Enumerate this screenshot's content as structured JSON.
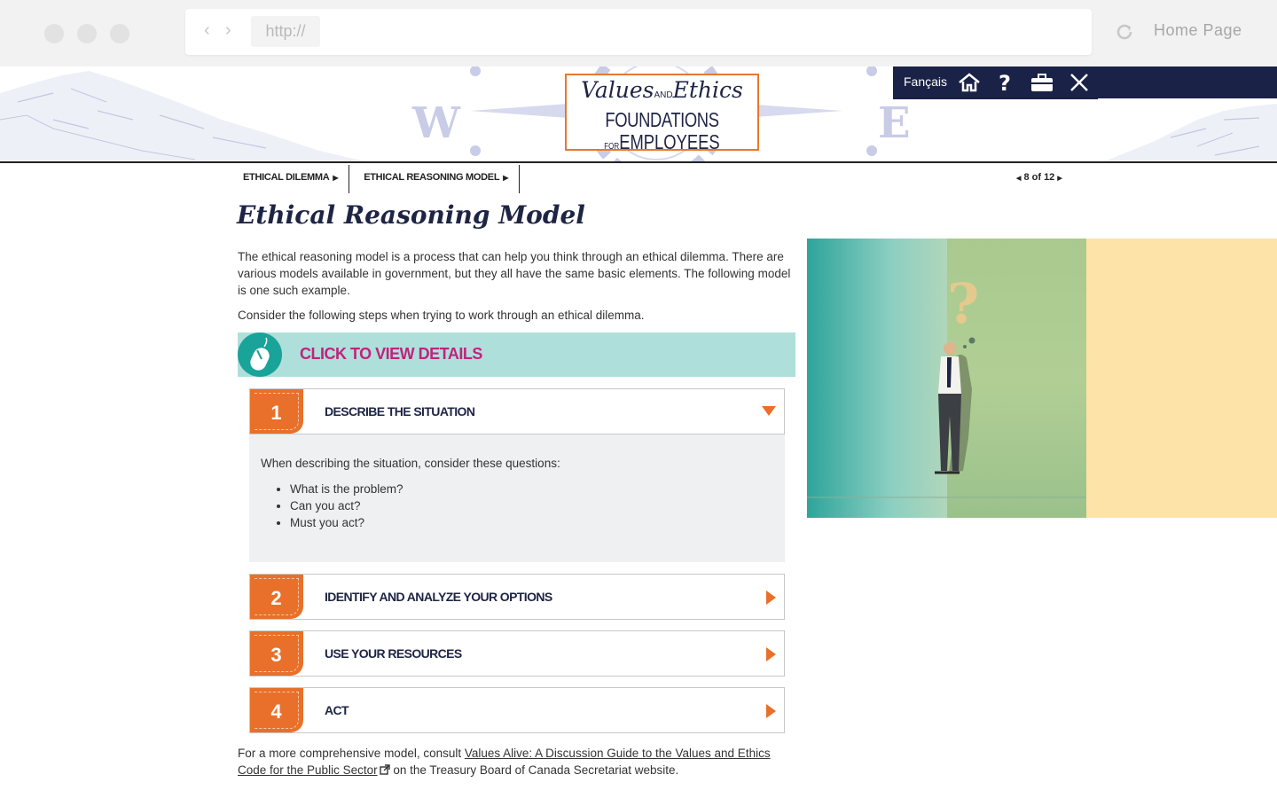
{
  "browser": {
    "url": "http://",
    "home_label": "Home Page"
  },
  "toolbar": {
    "language": "Fançais"
  },
  "logo": {
    "line1_a": "Values",
    "line1_and": "AND",
    "line1_b": "Ethics",
    "line2": "FOUNDATIONS",
    "line3_for": "FOR",
    "line3": "EMPLOYEES"
  },
  "breadcrumb": {
    "items": [
      "ETHICAL DILEMMA",
      "ETHICAL REASONING MODEL"
    ],
    "pager": "8 of 12"
  },
  "page": {
    "title": "Ethical Reasoning Model",
    "intro": "The ethical reasoning model is a process that can help you think through an ethical dilemma. There are various models available in government, but they all have the same basic elements. The following model is one such example.",
    "intro2": "Consider the following steps when trying to work through an ethical dilemma.",
    "click_label": "CLICK TO VIEW DETAILS"
  },
  "steps": [
    {
      "num": "1",
      "label": "DESCRIBE THE SITUATION"
    },
    {
      "num": "2",
      "label": "IDENTIFY AND ANALYZE YOUR OPTIONS"
    },
    {
      "num": "3",
      "label": "USE YOUR RESOURCES"
    },
    {
      "num": "4",
      "label": "ACT"
    }
  ],
  "panel": {
    "lead": "When describing the situation, consider these questions:",
    "questions": [
      "What is the problem?",
      "Can you act?",
      "Must you act?"
    ]
  },
  "footer": {
    "before": "For a more comprehensive model, consult ",
    "link": "Values Alive: A Discussion Guide to the Values and Ethics Code for the Public Sector",
    "after": " on the Treasury Board of Canada Secretariat website."
  },
  "colors": {
    "navy": "#1b2247",
    "orange": "#e8702a",
    "teal": "#1aa399",
    "magenta": "#c2227c"
  }
}
